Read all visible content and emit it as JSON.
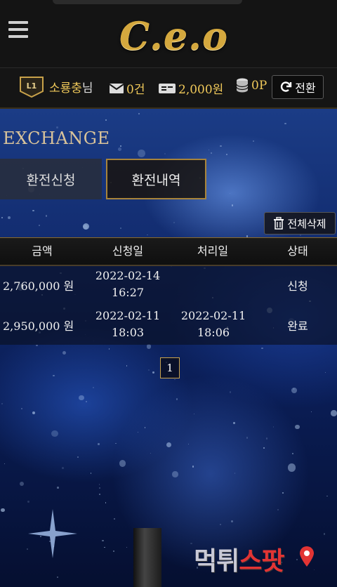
{
  "header": {
    "logo_text": "C.e.o"
  },
  "userbar": {
    "level": "L1",
    "username": "소룡충",
    "username_suffix": "님",
    "messages": "0건",
    "cash": "2,000원",
    "points": "0P",
    "convert_label": "전환"
  },
  "page": {
    "title": "EXCHANGE",
    "tabs": [
      {
        "label": "환전신청",
        "active": false
      },
      {
        "label": "환전내역",
        "active": true
      }
    ],
    "delete_all_label": "전체삭제"
  },
  "table": {
    "columns": [
      "금액",
      "신청일",
      "처리일",
      "상태"
    ],
    "rows": [
      {
        "amount": "2,760,000 원",
        "request_date": "2022-02-14",
        "request_time": "16:27",
        "process_date": "",
        "process_time": "",
        "status": "신청"
      },
      {
        "amount": "2,950,000 원",
        "request_date": "2022-02-11",
        "request_time": "18:03",
        "process_date": "2022-02-11",
        "process_time": "18:06",
        "status": "완료"
      }
    ]
  },
  "pagination": {
    "current": "1"
  },
  "watermark": {
    "part1": "먹튀",
    "part2": "스팟"
  },
  "colors": {
    "accent_gold": "#f0c95a",
    "border_gold": "#b08a3a",
    "bg_dark": "#151515"
  }
}
